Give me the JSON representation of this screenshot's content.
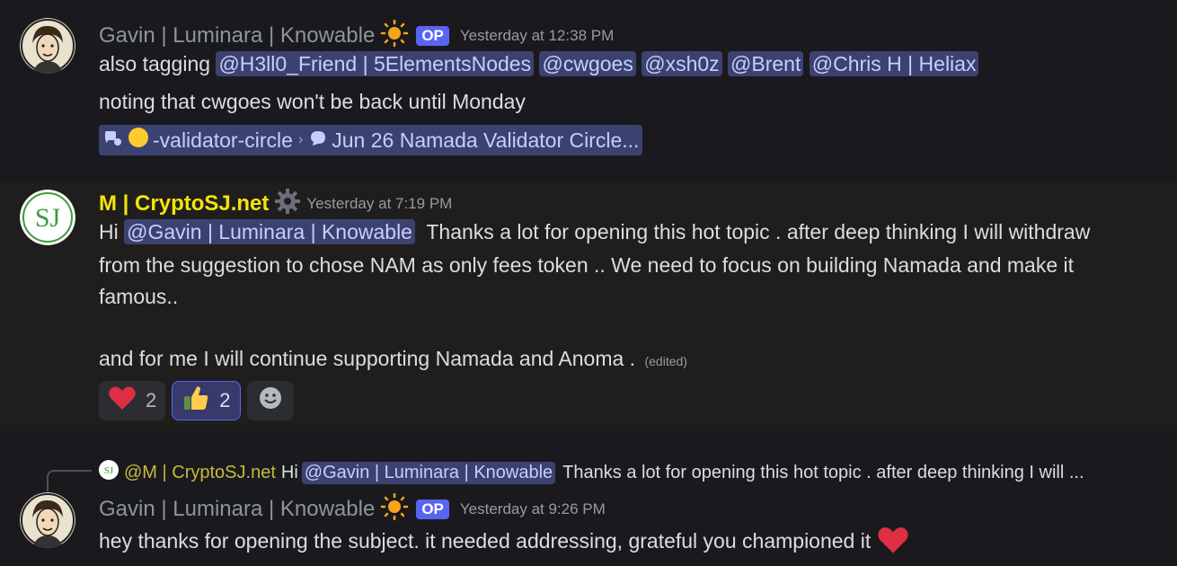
{
  "msg1": {
    "author": "Gavin | Luminara | Knowable",
    "op_badge": "OP",
    "timestamp": "Yesterday at 12:38 PM",
    "line1_prefix": "also tagging",
    "mentions": [
      "@H3ll0_Friend | 5ElementsNodes",
      "@cwgoes",
      "@xsh0z",
      "@Brent",
      "@Chris H | Heliax"
    ],
    "line2": "noting that cwgoes won't be back until Monday",
    "channel_link": "-validator-circle",
    "thread_link": "Jun 26 Namada Validator Circle..."
  },
  "msg2": {
    "author": "M | CryptoSJ.net",
    "timestamp": "Yesterday at 7:19 PM",
    "greeting": "Hi",
    "mention": "@Gavin | Luminara | Knowable",
    "line1_rest": "Thanks a lot for opening this hot topic . after deep thinking I will withdraw",
    "line2": "from the suggestion to chose NAM as only fees token .. We need to focus on building Namada and make it",
    "line3": "famous..",
    "line4": "and for me I will continue supporting Namada and Anoma .",
    "edited": "(edited)",
    "reactions": [
      {
        "emoji": "heart",
        "count": "2",
        "active": false
      },
      {
        "emoji": "thumbs-up",
        "count": "2",
        "active": true
      }
    ]
  },
  "msg3": {
    "reply_author": "@M | CryptoSJ.net",
    "reply_greeting": "Hi",
    "reply_mention": "@Gavin | Luminara | Knowable",
    "reply_snippet": "Thanks a lot for opening this hot topic . after deep thinking I will ...",
    "author": "Gavin | Luminara | Knowable",
    "op_badge": "OP",
    "timestamp": "Yesterday at 9:26 PM",
    "text": "hey thanks for opening the subject. it needed addressing, grateful you championed it"
  },
  "colors": {
    "background": "#1a1a1e",
    "highlight": "#201e1d",
    "mention_bg": "#3c4270",
    "mention_fg": "#c9cdfb",
    "op_badge": "#5865f2",
    "author_m": "#f4e409"
  }
}
